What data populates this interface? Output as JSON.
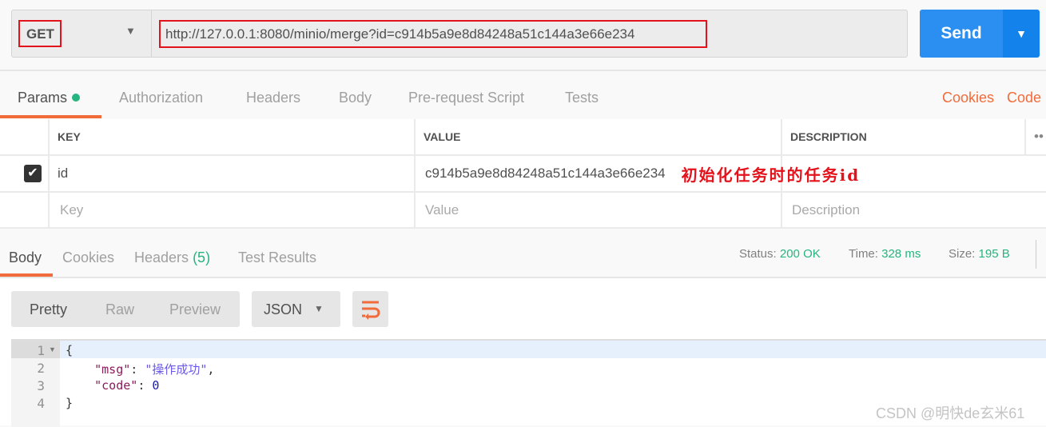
{
  "request": {
    "method": "GET",
    "url": "http://127.0.0.1:8080/minio/merge?id=c914b5a9e8d84248a51c144a3e66e234",
    "send_label": "Send"
  },
  "request_tabs": [
    {
      "label": "Params"
    },
    {
      "label": "Authorization"
    },
    {
      "label": "Headers"
    },
    {
      "label": "Body"
    },
    {
      "label": "Pre-request Script"
    },
    {
      "label": "Tests"
    }
  ],
  "links": {
    "cookies": "Cookies",
    "code": "Code"
  },
  "params_table": {
    "headers": [
      "KEY",
      "VALUE",
      "DESCRIPTION"
    ],
    "rows": [
      {
        "checked": true,
        "key": "id",
        "value": "c914b5a9e8d84248a51c144a3e66e234",
        "annotation": "初始化任务时的任务id"
      }
    ],
    "placeholder": {
      "key": "Key",
      "value": "Value",
      "description": "Description"
    }
  },
  "response_tabs": {
    "body": "Body",
    "cookies": "Cookies",
    "headers": "Headers",
    "headers_count": "(5)",
    "tests": "Test Results"
  },
  "status": {
    "status_label": "Status:",
    "status": "200 OK",
    "time_label": "Time:",
    "time": "328 ms",
    "size_label": "Size:",
    "size": "195 B"
  },
  "view": {
    "pretty": "Pretty",
    "raw": "Raw",
    "preview": "Preview",
    "format": "JSON"
  },
  "editor": {
    "lines": [
      "1",
      "2",
      "3",
      "4"
    ],
    "open": "{",
    "msg_key": "\"msg\"",
    "msg_val": "\"操作成功\"",
    "code_key": "\"code\"",
    "code_val": "0",
    "close": "}"
  },
  "watermark": "CSDN @明快de玄米61",
  "colors": {
    "accent": "#f26b3a",
    "send": "#2a8ff0",
    "success": "#26b47f",
    "highlight": "#e4121b"
  }
}
